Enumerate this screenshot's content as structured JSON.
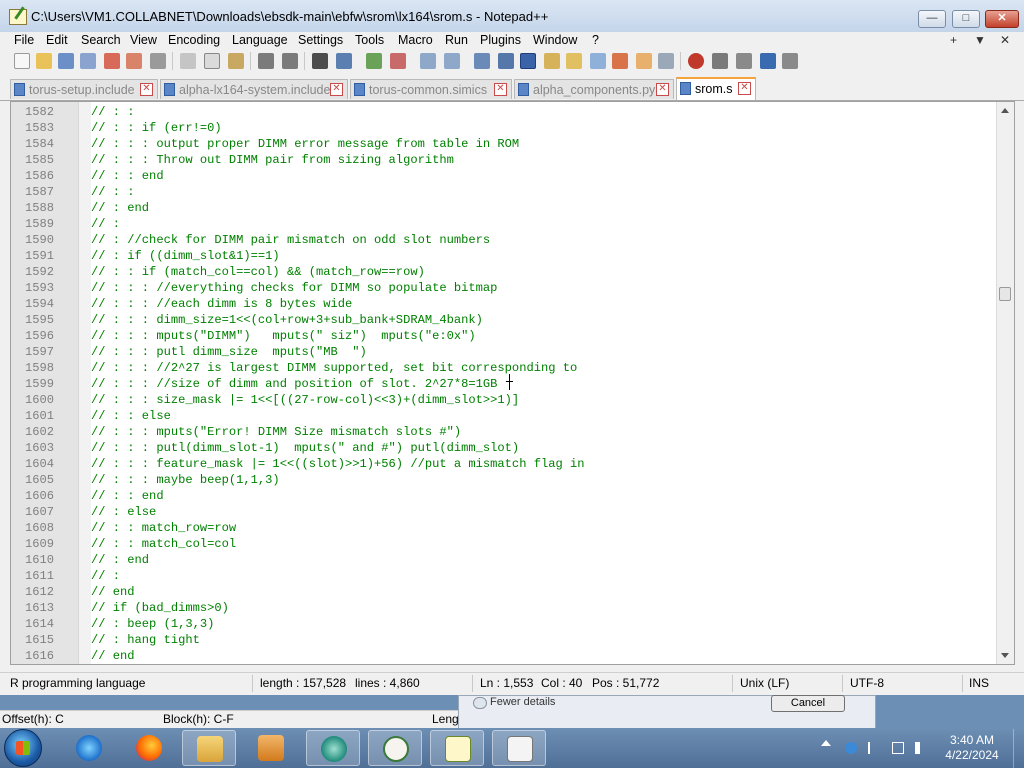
{
  "window": {
    "title": "C:\\Users\\VM1.COLLABNET\\Downloads\\ebsdk-main\\ebfw\\srom\\lx164\\srom.s - Notepad++"
  },
  "menu": [
    "File",
    "Edit",
    "Search",
    "View",
    "Encoding",
    "Language",
    "Settings",
    "Tools",
    "Macro",
    "Run",
    "Plugins",
    "Window",
    "?"
  ],
  "menu_right": [
    "+",
    "▼",
    "✕"
  ],
  "tabs": [
    {
      "label": "torus-setup.include",
      "active": false
    },
    {
      "label": "alpha-lx164-system.include",
      "active": false
    },
    {
      "label": "torus-common.simics",
      "active": false
    },
    {
      "label": "alpha_components.py",
      "active": false
    },
    {
      "label": "srom.s",
      "active": true
    }
  ],
  "editor": {
    "lines": [
      {
        "n": "1582",
        "t": "// : :"
      },
      {
        "n": "1583",
        "t": "// : : if (err!=0)"
      },
      {
        "n": "1584",
        "t": "// : : : output proper DIMM error message from table in ROM"
      },
      {
        "n": "1585",
        "t": "// : : : Throw out DIMM pair from sizing algorithm"
      },
      {
        "n": "1586",
        "t": "// : : end"
      },
      {
        "n": "1587",
        "t": "// : :"
      },
      {
        "n": "1588",
        "t": "// : end"
      },
      {
        "n": "1589",
        "t": "// :"
      },
      {
        "n": "1590",
        "t": "// : //check for DIMM pair mismatch on odd slot numbers"
      },
      {
        "n": "1591",
        "t": "// : if ((dimm_slot&1)==1)"
      },
      {
        "n": "1592",
        "t": "// : : if (match_col==col) && (match_row==row)"
      },
      {
        "n": "1593",
        "t": "// : : : //everything checks for DIMM so populate bitmap"
      },
      {
        "n": "1594",
        "t": "// : : : //each dimm is 8 bytes wide"
      },
      {
        "n": "1595",
        "t": "// : : : dimm_size=1<<(col+row+3+sub_bank+SDRAM_4bank)"
      },
      {
        "n": "1596",
        "t": "// : : : mputs(\"DIMM\")   mputs(\" siz\")  mputs(\"e:0x\")"
      },
      {
        "n": "1597",
        "t": "// : : : putl dimm_size  mputs(\"MB  \")"
      },
      {
        "n": "1598",
        "t": "// : : : //2^27 is largest DIMM supported, set bit corresponding to"
      },
      {
        "n": "1599",
        "t": "// : : : //size of dimm and position of slot. 2^27*8=1GB"
      },
      {
        "n": "1600",
        "t": "// : : : size_mask |= 1<<[((27-row-col)<<3)+(dimm_slot>>1)]"
      },
      {
        "n": "1601",
        "t": "// : : else"
      },
      {
        "n": "1602",
        "t": "// : : : mputs(\"Error! DIMM Size mismatch slots #\")"
      },
      {
        "n": "1603",
        "t": "// : : : putl(dimm_slot-1)  mputs(\" and #\") putl(dimm_slot)"
      },
      {
        "n": "1604",
        "t": "// : : : feature_mask |= 1<<((slot)>>1)+56) //put a mismatch flag in"
      },
      {
        "n": "1605",
        "t": "// : : : maybe beep(1,1,3)"
      },
      {
        "n": "1606",
        "t": "// : : end"
      },
      {
        "n": "1607",
        "t": "// : else"
      },
      {
        "n": "1608",
        "t": "// : : match_row=row"
      },
      {
        "n": "1609",
        "t": "// : : match_col=col"
      },
      {
        "n": "1610",
        "t": "// : end"
      },
      {
        "n": "1611",
        "t": "// :"
      },
      {
        "n": "1612",
        "t": "// end"
      },
      {
        "n": "1613",
        "t": "// if (bad_dimms>0)"
      },
      {
        "n": "1614",
        "t": "// : beep (1,3,3)"
      },
      {
        "n": "1615",
        "t": "// : hang tight"
      },
      {
        "n": "1616",
        "t": "// end"
      }
    ]
  },
  "status": {
    "language": "R programming language",
    "length": "length : 157,528",
    "lines": "lines : 4,860",
    "ln": "Ln : 1,553",
    "col": "Col : 40",
    "pos": "Pos : 51,772",
    "eol": "Unix (LF)",
    "encoding": "UTF-8",
    "mode": "INS"
  },
  "background": {
    "fewer_details": "Fewer details",
    "cancel": "Cancel",
    "offset": "Offset(h): C",
    "block": "Block(h): C-F",
    "length_short": "Leng"
  },
  "tray": {
    "time": "3:40 AM",
    "date": "4/22/2024"
  }
}
